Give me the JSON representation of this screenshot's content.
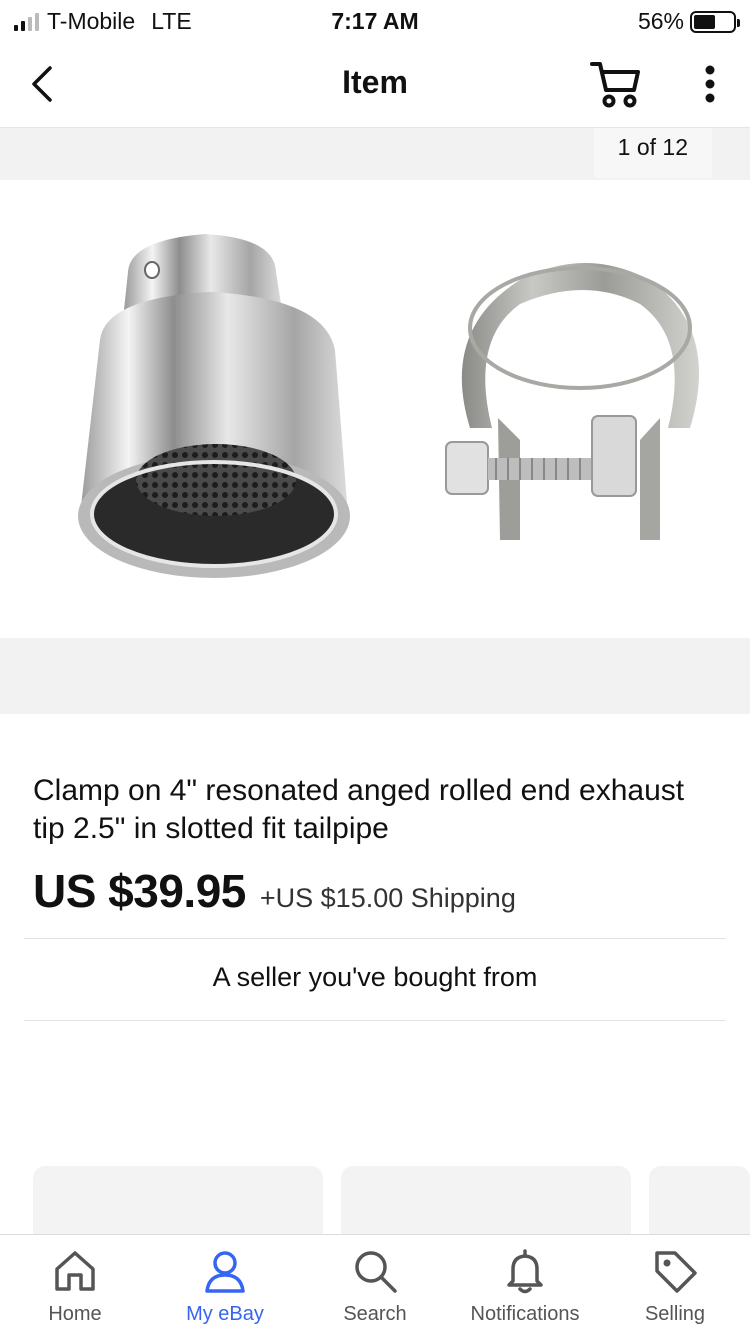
{
  "status_bar": {
    "carrier": "T-Mobile",
    "network": "LTE",
    "time": "7:17 AM",
    "battery": "56%",
    "battery_level": 0.56
  },
  "nav": {
    "title": "Item"
  },
  "gallery": {
    "counter": "1 of 12"
  },
  "item": {
    "title": "Clamp on 4\" resonated anged rolled end exhaust tip 2.5\" in slotted fit tailpipe",
    "price": "US $39.95",
    "shipping": "+US $15.00 Shipping",
    "seller_note": "A seller you've bought from"
  },
  "tabs": [
    {
      "label": "Home",
      "icon": "home-icon"
    },
    {
      "label": "My eBay",
      "icon": "person-icon",
      "active": true
    },
    {
      "label": "Search",
      "icon": "search-icon"
    },
    {
      "label": "Notifications",
      "icon": "bell-icon"
    },
    {
      "label": "Selling",
      "icon": "tag-icon"
    }
  ],
  "colors": {
    "accent": "#3665f3",
    "gallery_bg": "#f2f2f2"
  }
}
